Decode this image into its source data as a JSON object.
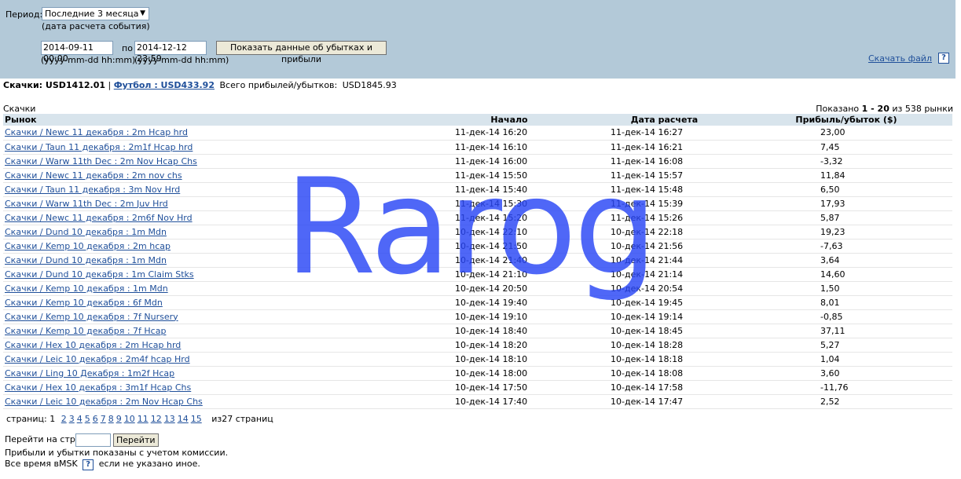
{
  "filter": {
    "period_label": "Период:",
    "period_value": "Последние 3 месяца",
    "period_hint": "(дата расчета события)",
    "from_value": "2014-09-11 00:00",
    "to_label": "по",
    "to_value": "2014-12-12 23:59",
    "date_format_hint": "(yyyy-mm-dd hh:mm)",
    "show_button": "Показать данные об убытках и прибыли",
    "download_link": "Скачать файл",
    "help": "?"
  },
  "summary": {
    "racing": "Скачки: USD1412.01",
    "separator": "|",
    "football": "Футбол : USD433.92",
    "total_label": "Всего прибылей/убытков:",
    "total_value": "USD1845.93"
  },
  "section_title": "Скачки",
  "shown": {
    "prefix": "Показано",
    "range": "1 - 20",
    "suffix": "из 538 рынки"
  },
  "table": {
    "headers": {
      "market": "Рынок",
      "start": "Начало",
      "settled": "Дата расчета",
      "pl": "Прибыль/убыток ($)"
    },
    "rows": [
      {
        "market": "Скачки / Newc 11 декабря : 2m Hcap hrd",
        "start": "11-дек-14 16:20",
        "settled": "11-дек-14 16:27",
        "pl": "23,00"
      },
      {
        "market": "Скачки / Taun 11 декабря : 2m1f Hcap hrd",
        "start": "11-дек-14 16:10",
        "settled": "11-дек-14 16:21",
        "pl": "7,45"
      },
      {
        "market": "Скачки / Warw 11th Dec : 2m Nov Hcap Chs",
        "start": "11-дек-14 16:00",
        "settled": "11-дек-14 16:08",
        "pl": "-3,32"
      },
      {
        "market": "Скачки / Newc 11 декабря : 2m nov chs",
        "start": "11-дек-14 15:50",
        "settled": "11-дек-14 15:57",
        "pl": "11,84"
      },
      {
        "market": "Скачки / Taun 11 декабря : 3m Nov Hrd",
        "start": "11-дек-14 15:40",
        "settled": "11-дек-14 15:48",
        "pl": "6,50"
      },
      {
        "market": "Скачки / Warw 11th Dec : 2m Juv Hrd",
        "start": "11-дек-14 15:30",
        "settled": "11-дек-14 15:39",
        "pl": "17,93"
      },
      {
        "market": "Скачки / Newc 11 декабря : 2m6f Nov Hrd",
        "start": "11-дек-14 15:20",
        "settled": "11-дек-14 15:26",
        "pl": "5,87"
      },
      {
        "market": "Скачки / Dund 10 декабря : 1m Mdn",
        "start": "10-дек-14 22:10",
        "settled": "10-дек-14 22:18",
        "pl": "19,23"
      },
      {
        "market": "Скачки / Kemp 10 декабря : 2m hcap",
        "start": "10-дек-14 21:50",
        "settled": "10-дек-14 21:56",
        "pl": "-7,63"
      },
      {
        "market": "Скачки / Dund 10 декабря : 1m Mdn",
        "start": "10-дек-14 21:40",
        "settled": "10-дек-14 21:44",
        "pl": "3,64"
      },
      {
        "market": "Скачки / Dund 10 декабря : 1m Claim Stks",
        "start": "10-дек-14 21:10",
        "settled": "10-дек-14 21:14",
        "pl": "14,60"
      },
      {
        "market": "Скачки / Kemp 10 декабря : 1m Mdn",
        "start": "10-дек-14 20:50",
        "settled": "10-дек-14 20:54",
        "pl": "1,50"
      },
      {
        "market": "Скачки / Kemp 10 декабря : 6f Mdn",
        "start": "10-дек-14 19:40",
        "settled": "10-дек-14 19:45",
        "pl": "8,01"
      },
      {
        "market": "Скачки / Kemp 10 декабря : 7f Nursery",
        "start": "10-дек-14 19:10",
        "settled": "10-дек-14 19:14",
        "pl": "-0,85"
      },
      {
        "market": "Скачки / Kemp 10 декабря : 7f Hcap",
        "start": "10-дек-14 18:40",
        "settled": "10-дек-14 18:45",
        "pl": "37,11"
      },
      {
        "market": "Скачки / Hex 10 декабря : 2m Hcap hrd",
        "start": "10-дек-14 18:20",
        "settled": "10-дек-14 18:28",
        "pl": "5,27"
      },
      {
        "market": "Скачки / Leic 10 декабря : 2m4f hcap Hrd",
        "start": "10-дек-14 18:10",
        "settled": "10-дек-14 18:18",
        "pl": "1,04"
      },
      {
        "market": "Скачки / Ling 10 Декабря : 1m2f Hcap",
        "start": "10-дек-14 18:00",
        "settled": "10-дек-14 18:08",
        "pl": "3,60"
      },
      {
        "market": "Скачки / Hex 10 декабря : 3m1f Hcap Chs",
        "start": "10-дек-14 17:50",
        "settled": "10-дек-14 17:58",
        "pl": "-11,76"
      },
      {
        "market": "Скачки / Leic 10 декабря : 2m Nov Hcap Chs",
        "start": "10-дек-14 17:40",
        "settled": "10-дек-14 17:47",
        "pl": "2,52"
      }
    ]
  },
  "pagination": {
    "label": "страниц:",
    "current": "1",
    "pages": [
      "2",
      "3",
      "4",
      "5",
      "6",
      "7",
      "8",
      "9",
      "10",
      "11",
      "12",
      "13",
      "14",
      "15"
    ],
    "total": "из27 страниц"
  },
  "goto": {
    "label": "Перейти на стр.:",
    "button": "Перейти"
  },
  "notes": {
    "commission": "Прибыли и убытки показаны с учетом комиссии.",
    "time_prefix": "Все время вMSK",
    "time_suffix": "если не указано иное."
  },
  "watermark": "Rarog"
}
